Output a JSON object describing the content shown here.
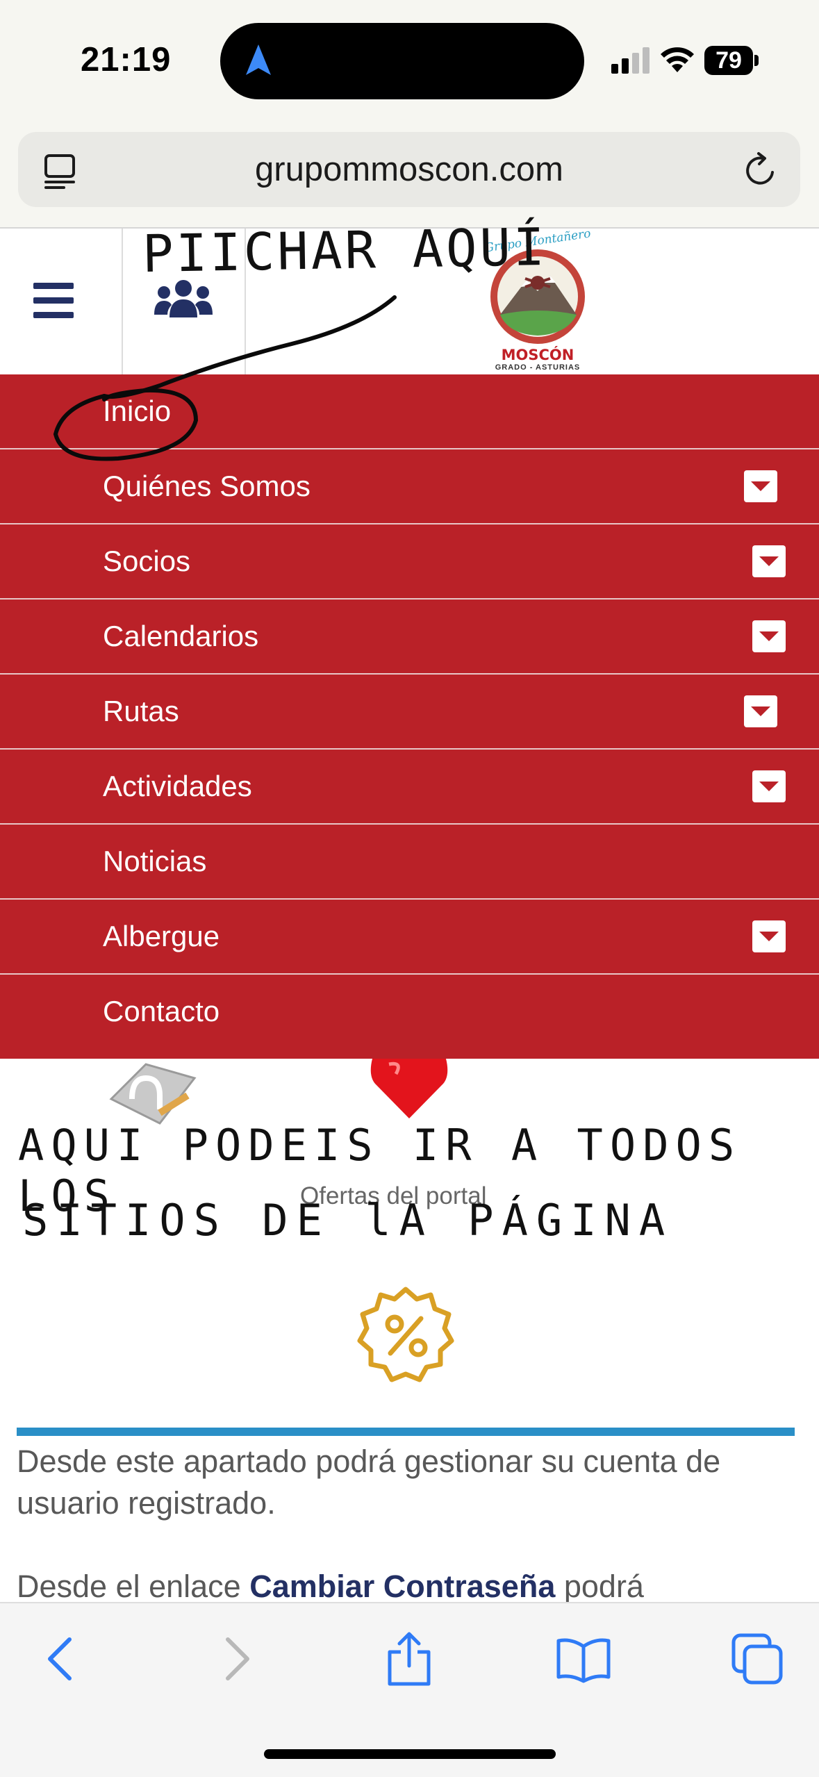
{
  "status_bar": {
    "time": "21:19",
    "battery": "79"
  },
  "browser": {
    "url": "grupommoscon.com"
  },
  "site": {
    "logo": {
      "title": "Grupo Montañero",
      "name": "MOSCÓN",
      "subtitle": "GRADO - ASTURIAS"
    }
  },
  "menu": {
    "items": [
      {
        "label": "Inicio",
        "has_submenu": false
      },
      {
        "label": "Quiénes Somos",
        "has_submenu": true
      },
      {
        "label": "Socios",
        "has_submenu": true
      },
      {
        "label": "Calendarios",
        "has_submenu": true
      },
      {
        "label": "Rutas",
        "has_submenu": true
      },
      {
        "label": "Actividades",
        "has_submenu": true
      },
      {
        "label": "Noticias",
        "has_submenu": false
      },
      {
        "label": "Albergue",
        "has_submenu": true
      },
      {
        "label": "Contacto",
        "has_submenu": false
      }
    ]
  },
  "content": {
    "offers_label": "Ofertas del portal",
    "account_text": "Desde este apartado podrá gestionar su cuenta de usuario registrado.",
    "password_prefix": "Desde el enlace ",
    "password_link": "Cambiar Contraseña",
    "password_suffix": " podrá"
  },
  "annotations": {
    "click_here": "PIICHAR AQUÍ",
    "line1": "AQUI PODEIS IR A TODOS LOS",
    "line2": "SITIOS DE lA PÁGINA"
  },
  "colors": {
    "menu_red": "#ba2128",
    "navy": "#233064",
    "accent_blue": "#2a8fc7",
    "ios_blue": "#2f7bf6"
  }
}
